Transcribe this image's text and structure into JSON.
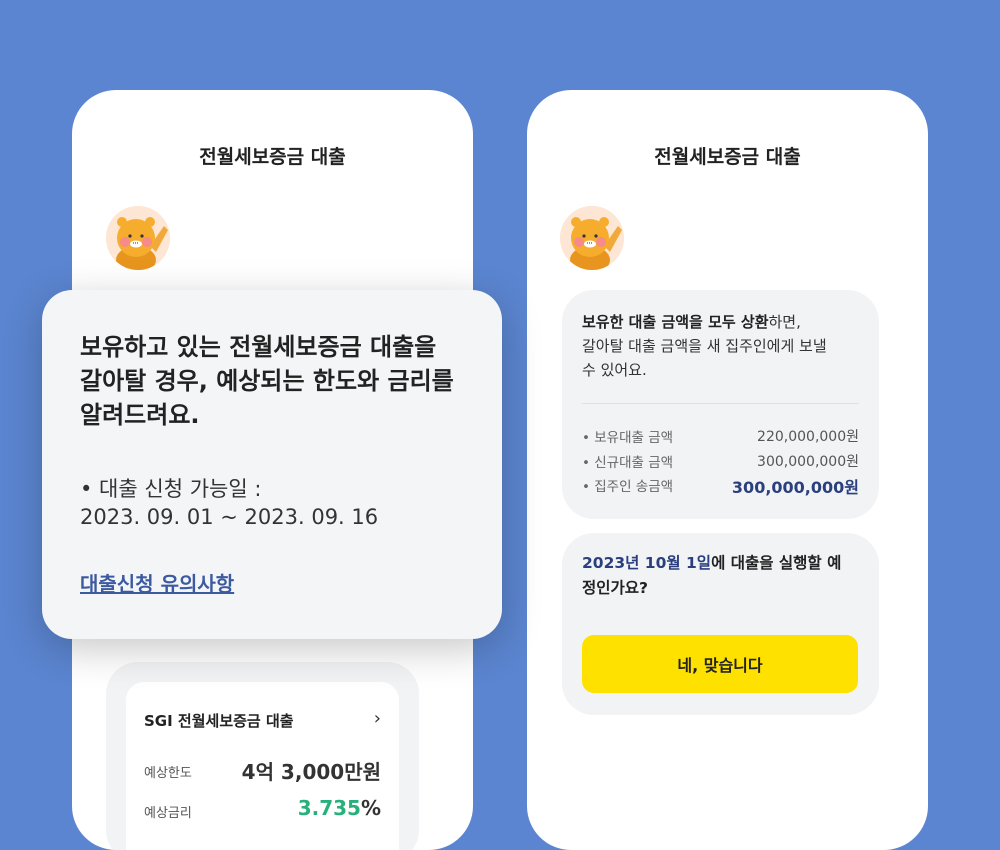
{
  "left_phone": {
    "title": "전월세보증금 대출",
    "loan_card": {
      "title": "SGI 전월세보증금 대출",
      "chevron": "›",
      "limit_label": "예상한도",
      "limit_value": "4억 3,000만원",
      "rate_label": "예상금리",
      "rate_number": "3.735",
      "rate_unit": "%"
    }
  },
  "overlay": {
    "headline_line1": "보유하고 있는 전월세보증금 대출을",
    "headline_line2": "갈아탈 경우, 예상되는 한도와 금리를",
    "headline_line3": "알려드려요.",
    "bullet_label": "• 대출 신청 가능일 :",
    "date_range": "2023. 09. 01 ~ 2023. 09. 16",
    "link_label": "대출신청 유의사항"
  },
  "right_phone": {
    "title": "전월세보증금 대출",
    "repay_card": {
      "text_bold": "보유한 대출 금액을 모두 상환",
      "text_rest1": "하면,",
      "text_line2": "갈아탈 대출 금액을 새 집주인에게 보낼",
      "text_line3": "수 있어요.",
      "rows": [
        {
          "label": "• 보유대출 금액",
          "value": "220,000,000원"
        },
        {
          "label": "• 신규대출 금액",
          "value": "300,000,000원"
        },
        {
          "label": "• 집주인 송금액",
          "value": "300,000,000원"
        }
      ]
    },
    "date_card": {
      "highlight": "2023년 10월 1일",
      "question_rest1": "에 대출을 실행할 예",
      "question_line2": "정인가요?",
      "button_label": "네, 맞습니다"
    }
  },
  "colors": {
    "background": "#5b85d0",
    "accent_yellow": "#ffe100",
    "rate_green": "#27b07b",
    "highlight_navy": "#2b3f7e"
  }
}
